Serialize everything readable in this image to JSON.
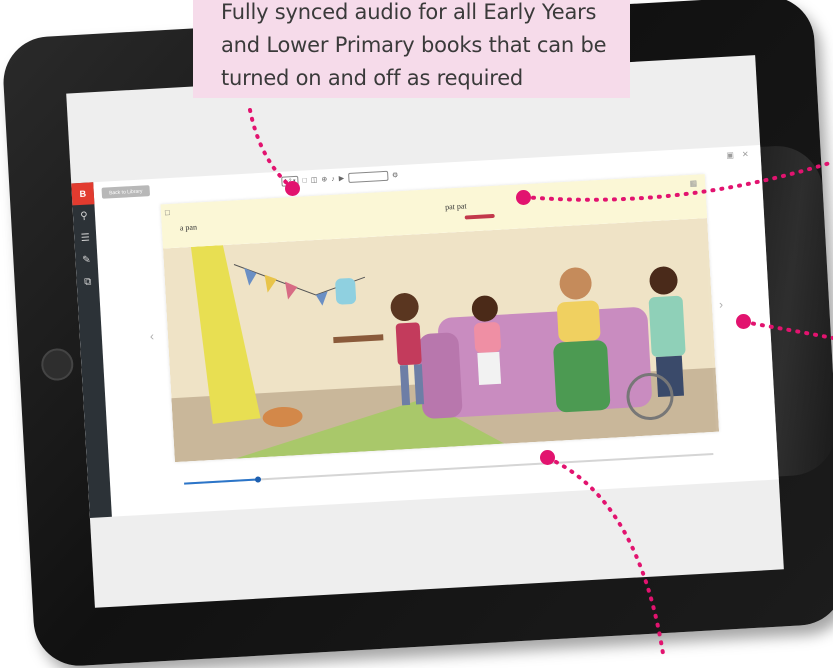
{
  "callout": {
    "line1": "Fully synced audio for all Early Years",
    "line2": "and Lower Primary books that can be",
    "line3": "turned on and off as required"
  },
  "app": {
    "logo": "B",
    "back_label": "Back to Library",
    "page_label": "1-2",
    "captions": {
      "left": "a pan",
      "right": "pat pat"
    },
    "toolbar_icons": [
      "search-icon",
      "menu-icon",
      "pencil-icon",
      "export-icon"
    ],
    "progress": 0.14
  },
  "colors": {
    "accent": "#e2136f",
    "callout_bg": "#f6dbea",
    "text_strip": "#fbf7d6",
    "logo": "#e23b2f"
  }
}
